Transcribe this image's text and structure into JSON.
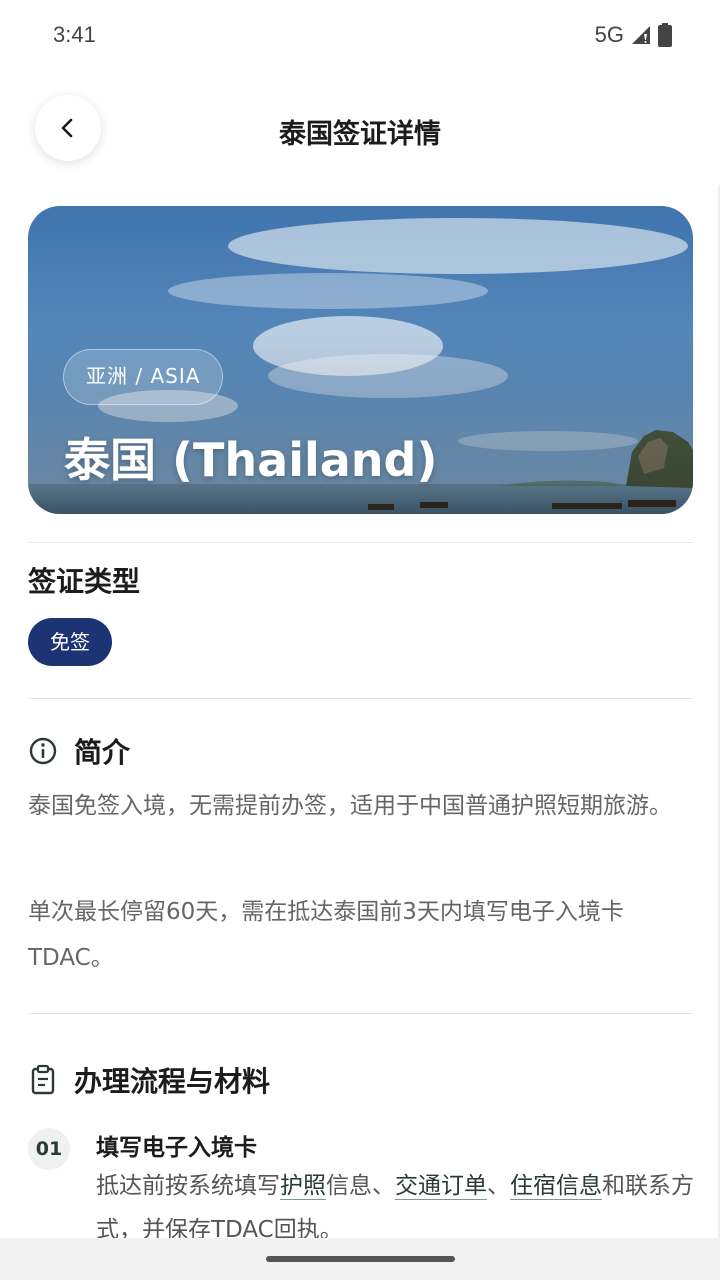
{
  "status": {
    "time": "3:41",
    "network": "5G",
    "icons": [
      "signal-icon",
      "battery-icon"
    ]
  },
  "header": {
    "title": "泰国签证详情",
    "back_icon": "chevron-left-icon"
  },
  "hero": {
    "region_badge": "亚洲 / ASIA",
    "country_title": "泰国 (Thailand)"
  },
  "visa_type": {
    "heading": "签证类型",
    "chip": "免签",
    "chip_color": "#1c3474"
  },
  "intro": {
    "heading": "简介",
    "icon": "info-icon",
    "paragraphs": [
      "泰国免签入境，无需提前办签，适用于中国普通护照短期旅游。",
      "单次最长停留60天，需在抵达泰国前3天内填写电子入境卡 TDAC。"
    ]
  },
  "process": {
    "heading": "办理流程与材料",
    "icon": "clipboard-icon",
    "steps": [
      {
        "num": "01",
        "title": "填写电子入境卡",
        "desc_parts": [
          "抵达前按系统填写",
          "护照",
          "信息、",
          "交通订单",
          "、",
          "住宿信息",
          "和联系方式，并保存TDAC回执。"
        ]
      }
    ]
  },
  "colors": {
    "accent_dark_green": "#2a3a34",
    "chip_navy": "#1c3474"
  }
}
